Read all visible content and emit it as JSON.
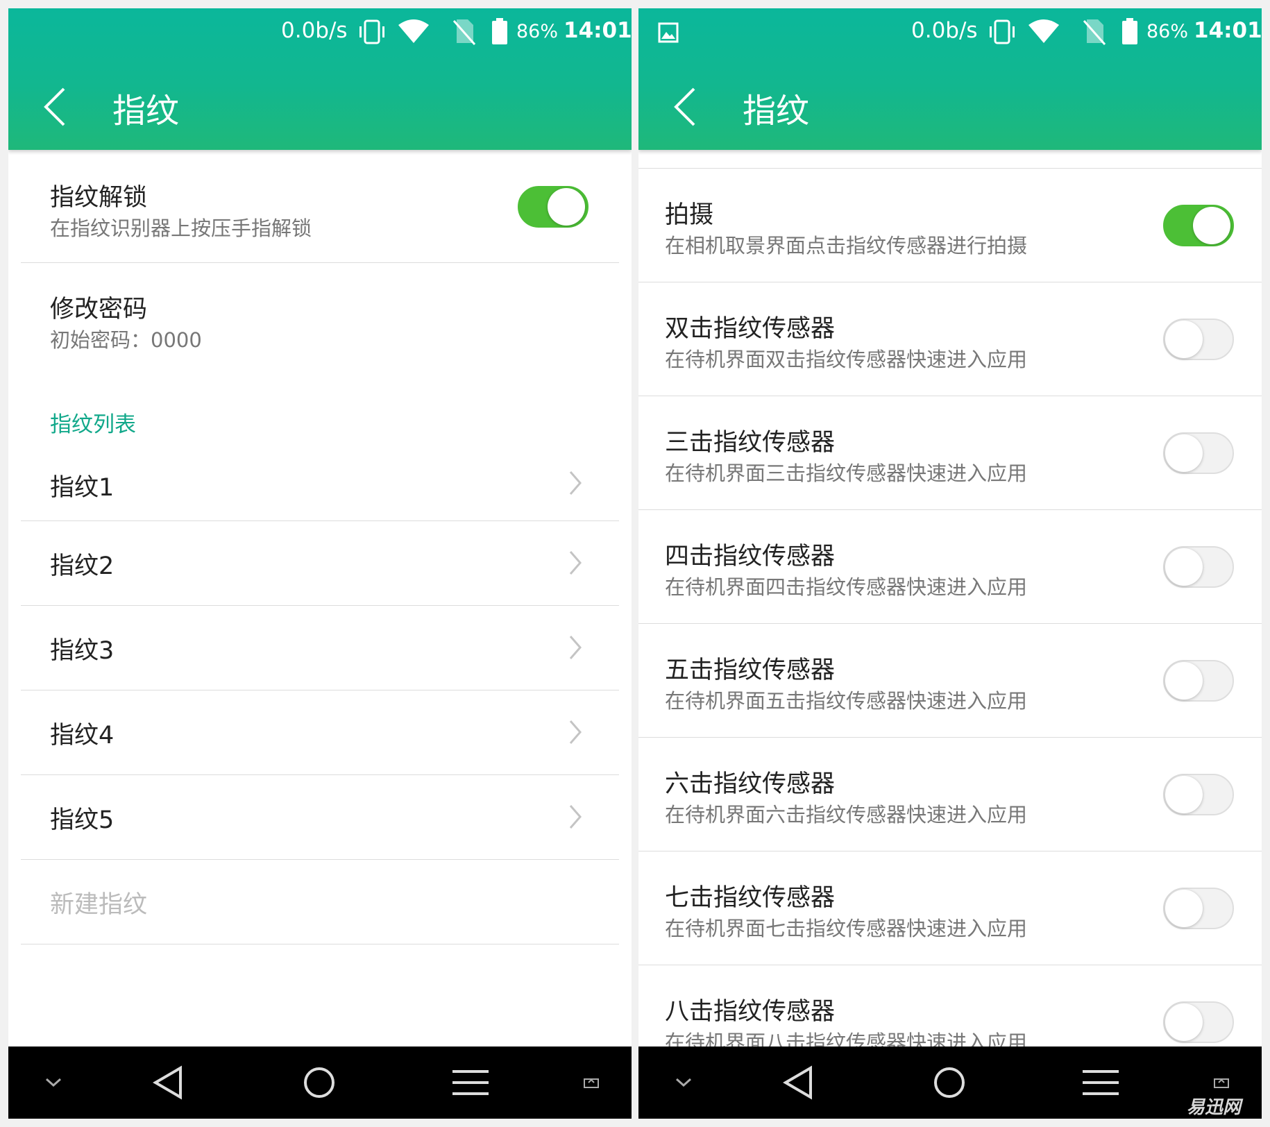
{
  "status_bar": {
    "speed": "0.0b/s",
    "battery_pct": "86%",
    "time": "14:01",
    "icons": [
      "image-icon",
      "vibrate-icon",
      "wifi-icon",
      "no-sim-icon",
      "battery-icon"
    ]
  },
  "header": {
    "title": "指纹",
    "back_icon": "chevron-left-icon"
  },
  "left": {
    "unlock": {
      "title": "指纹解锁",
      "subtitle": "在指纹识别器上按压手指解锁",
      "enabled": true
    },
    "password": {
      "title": "修改密码",
      "subtitle": "初始密码：0000"
    },
    "section_label": "指纹列表",
    "fingerprints": [
      "指纹1",
      "指纹2",
      "指纹3",
      "指纹4",
      "指纹5"
    ],
    "new_fingerprint": "新建指纹"
  },
  "right": {
    "items": [
      {
        "title": "拍摄",
        "subtitle": "在相机取景界面点击指纹传感器进行拍摄",
        "enabled": true
      },
      {
        "title": "双击指纹传感器",
        "subtitle": "在待机界面双击指纹传感器快速进入应用",
        "enabled": false
      },
      {
        "title": "三击指纹传感器",
        "subtitle": "在待机界面三击指纹传感器快速进入应用",
        "enabled": false
      },
      {
        "title": "四击指纹传感器",
        "subtitle": "在待机界面四击指纹传感器快速进入应用",
        "enabled": false
      },
      {
        "title": "五击指纹传感器",
        "subtitle": "在待机界面五击指纹传感器快速进入应用",
        "enabled": false
      },
      {
        "title": "六击指纹传感器",
        "subtitle": "在待机界面六击指纹传感器快速进入应用",
        "enabled": false
      },
      {
        "title": "七击指纹传感器",
        "subtitle": "在待机界面七击指纹传感器快速进入应用",
        "enabled": false
      },
      {
        "title": "八击指纹传感器",
        "subtitle": "在待机界面八击指纹传感器快速进入应用",
        "enabled": false
      }
    ]
  },
  "navbar": {
    "icons": [
      "chevron-down-icon",
      "back-triangle-icon",
      "home-circle-icon",
      "menu-icon",
      "screenshot-icon"
    ]
  },
  "watermark": "易迅网",
  "colors": {
    "accent": "#11b894",
    "toggle_on": "#4cbf36",
    "section": "#11a88a"
  }
}
